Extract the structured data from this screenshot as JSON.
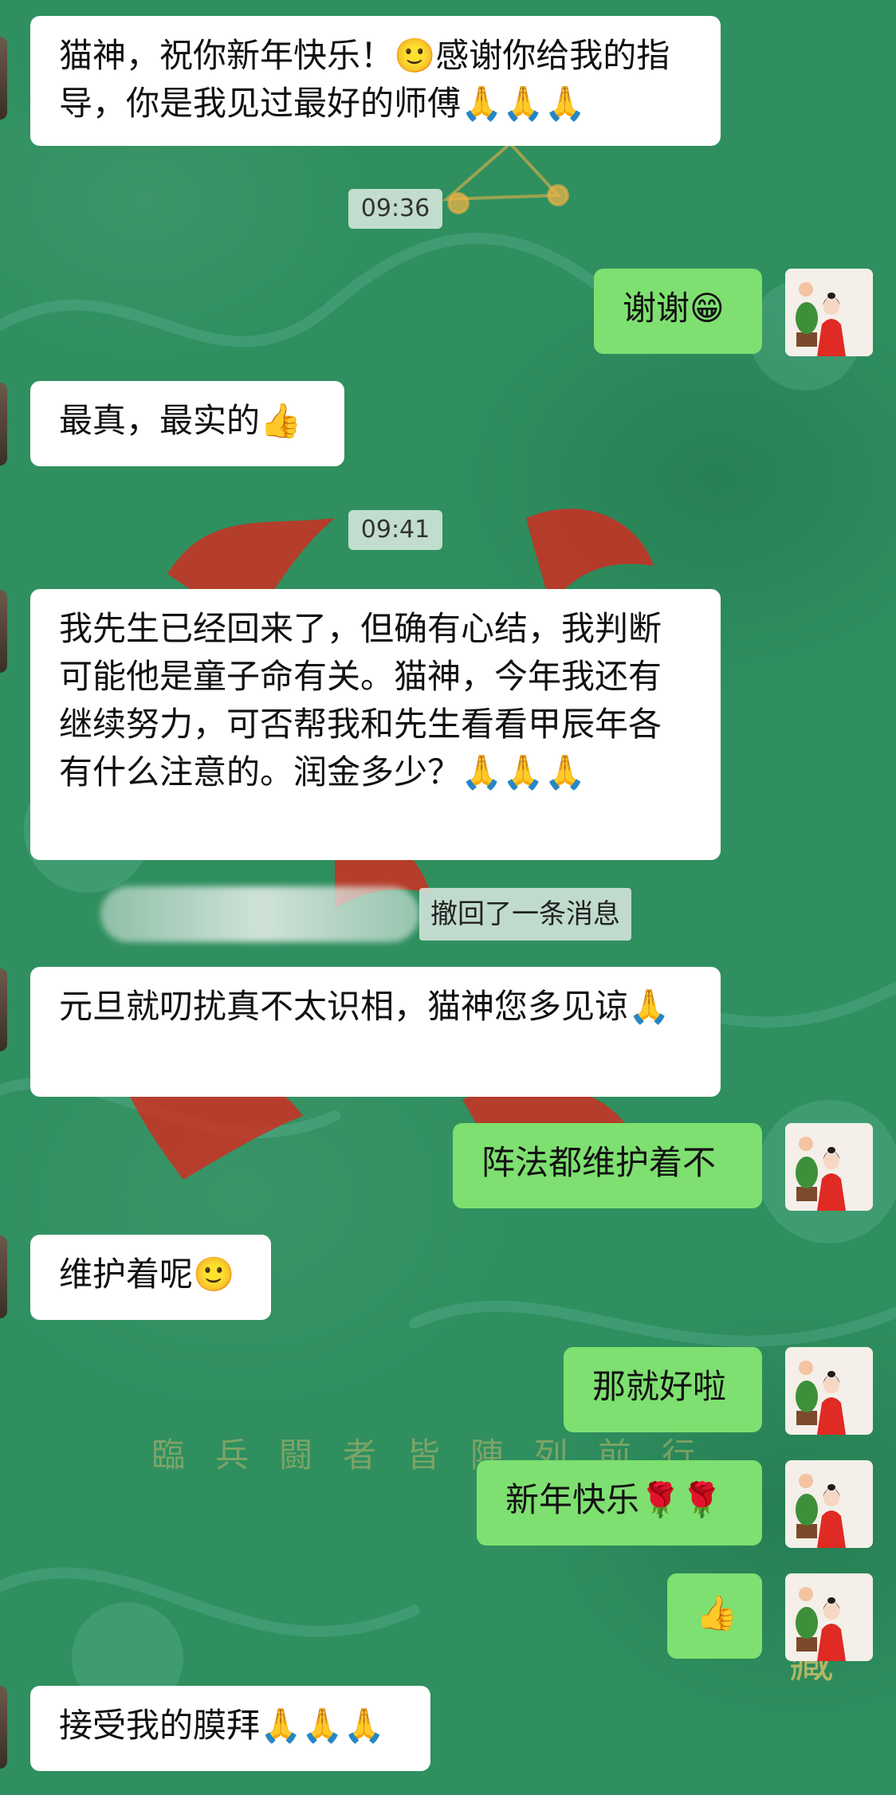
{
  "chat": {
    "messages": [
      {
        "type": "text",
        "side": "in",
        "text": "猫神，祝你新年快乐！🙂感谢你给我的指导，你是我见过最好的师傅🙏🙏🙏"
      },
      {
        "type": "time",
        "text": "09:36"
      },
      {
        "type": "text",
        "side": "out",
        "text": "谢谢😁"
      },
      {
        "type": "text",
        "side": "in",
        "text": "最真，最实的👍"
      },
      {
        "type": "time",
        "text": "09:41"
      },
      {
        "type": "text",
        "side": "in",
        "text": "我先生已经回来了，但确有心结，我判断可能他是童子命有关。猫神，今年我还有继续努力，可否帮我和先生看看甲辰年各有什么注意的。润金多少？🙏🙏🙏"
      },
      {
        "type": "recall",
        "text": "撤回了一条消息"
      },
      {
        "type": "text",
        "side": "in",
        "text": "元旦就叨扰真不太识相，猫神您多见谅🙏"
      },
      {
        "type": "text",
        "side": "out",
        "text": "阵法都维护着不"
      },
      {
        "type": "text",
        "side": "in",
        "text": "维护着呢🙂"
      },
      {
        "type": "text",
        "side": "out",
        "text": "那就好啦"
      },
      {
        "type": "text",
        "side": "out",
        "text": "新年快乐🌹🌹"
      },
      {
        "type": "text",
        "side": "out",
        "text": "👍"
      },
      {
        "type": "text",
        "side": "in",
        "text": "接受我的膜拜🙏🙏🙏"
      }
    ]
  },
  "background": {
    "caption": "臨兵闘者皆陣列前行",
    "seal": "藏"
  },
  "colors": {
    "background": "#2f8f5f",
    "incoming_bubble": "#ffffff",
    "outgoing_bubble": "#7ee070"
  },
  "icons": {
    "avatar": "avatar-woman-in-red-with-bonsai"
  }
}
